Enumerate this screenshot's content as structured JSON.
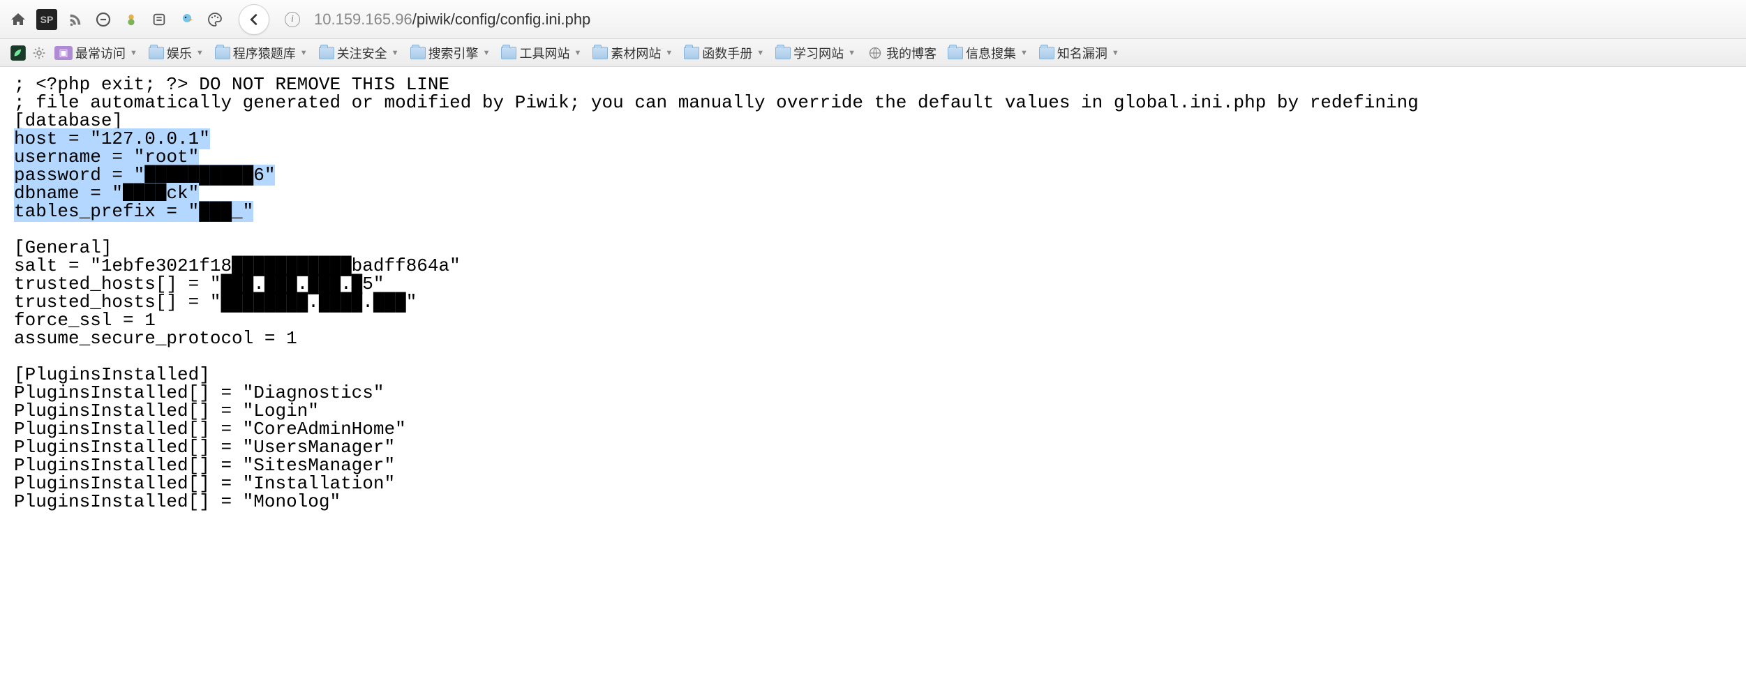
{
  "nav": {
    "url_host": "10.159.165.96",
    "url_path": "/piwik/config/config.ini.php"
  },
  "bookmarks": {
    "most_visited": "最常访问",
    "items": [
      {
        "label": "娱乐"
      },
      {
        "label": "程序猿题库"
      },
      {
        "label": "关注安全"
      },
      {
        "label": "搜索引擎"
      },
      {
        "label": "工具网站"
      },
      {
        "label": "素材网站"
      },
      {
        "label": "函数手册"
      },
      {
        "label": "学习网站"
      }
    ],
    "my_blog": "我的博客",
    "info_collect": "信息搜集",
    "known_vuln": "知名漏洞"
  },
  "file": {
    "line1": "; <?php exit; ?> DO NOT REMOVE THIS LINE",
    "line2": "; file automatically generated or modified by Piwik; you can manually override the default values in global.ini.php by redefining",
    "db_section": "[database]",
    "host_key": "host = \"",
    "host_val": "127.0.0.1",
    "host_end": "\"",
    "username_key": "username = \"",
    "username_val": "root",
    "username_end": "\"",
    "password_key": "password = \"",
    "password_val": "██████████6",
    "password_end": "\"",
    "dbname_key": "dbname = \"",
    "dbname_val": "████ck",
    "dbname_end": "\"",
    "prefix_key": "tables_prefix = \"",
    "prefix_val": "███_",
    "prefix_end": "\"",
    "general_section": "[General]",
    "salt": "salt = \"1ebfe3021f18███████████badff864a\"",
    "th1": "trusted_hosts[] = \"███.███.███.█5\"",
    "th2": "trusted_hosts[] = \"████████.████.███\"",
    "force_ssl": "force_ssl = 1",
    "assume": "assume_secure_protocol = 1",
    "pi_section": "[PluginsInstalled]",
    "pi1": "PluginsInstalled[] = \"Diagnostics\"",
    "pi2": "PluginsInstalled[] = \"Login\"",
    "pi3": "PluginsInstalled[] = \"CoreAdminHome\"",
    "pi4": "PluginsInstalled[] = \"UsersManager\"",
    "pi5": "PluginsInstalled[] = \"SitesManager\"",
    "pi6": "PluginsInstalled[] = \"Installation\"",
    "pi7": "PluginsInstalled[] = \"Monolog\""
  }
}
